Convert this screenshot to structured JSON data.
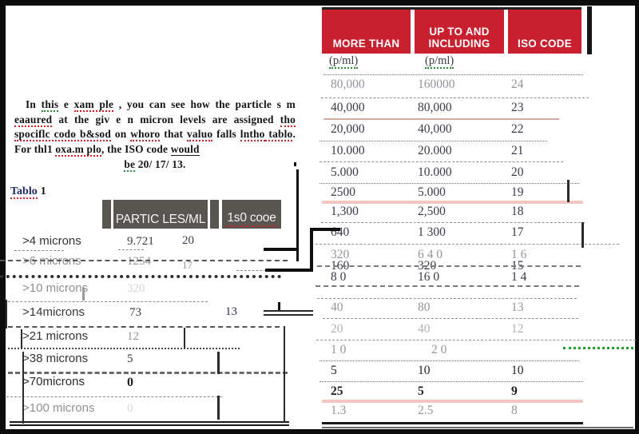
{
  "document": {
    "intro_paragraph": {
      "line1_pre": "In ",
      "line1_a": "this",
      "line1_b": " e ",
      "line1_c": "xam ple",
      "line1_d": " , you can see  how the particle s",
      "line2_a": "m ",
      "line2_b": "eaaured",
      "line2_c": " at the giv e n  micron  levels  are  assigned",
      "line3_a": "tho",
      "line3_b": " spociflc codo b&sod",
      "line3_c": " on ",
      "line3_d": "whoro",
      "line3_e": " that ",
      "line3_f": "valuo",
      "line3_g": " falls",
      "line4_a": "lntho",
      "line4_b": " tablo",
      "line4_c": ". For thl1 ",
      "line4_d": "oxa.m plo",
      "line4_e": ", the ISO code ",
      "line4_f": "would",
      "line5_a": "be",
      "line5_b": " 20/ 17/ 13.",
      "full_text": "In this e xam ple , you can see how the particle s m eaaured at the given micron levels are assigned tho spociflc codo b&sod on whoro that valuo falls lntho tablo. For thl1 oxa.m plo, the ISO code would be 20/17/13."
    },
    "table1_caption": {
      "word": "Tablo",
      "number": "1"
    }
  },
  "left_table": {
    "name": "Tablo 1 particle count table",
    "header": {
      "block_a": "",
      "particles_label": "PARTIC LES/ML",
      "block_c": "",
      "iso_label": "1s0 cooe"
    },
    "rows": [
      {
        "micron": ">4 microns",
        "count": "9.721",
        "iso": "20"
      },
      {
        "micron": ">6 microns",
        "count": "1254",
        "iso": "17"
      },
      {
        "micron": ">10 microns",
        "count": "320",
        "iso": ""
      },
      {
        "micron": ">14microns",
        "count": "73",
        "iso": "13"
      },
      {
        "micron": ">21 microns",
        "count": "12",
        "iso": ""
      },
      {
        "micron": ">38 microns",
        "count": "5",
        "iso": ""
      },
      {
        "micron": ">70microns",
        "count": "0",
        "iso": ""
      },
      {
        "micron": ">100 microns",
        "count": "0",
        "iso": ""
      }
    ]
  },
  "right_table": {
    "name": "ISO 4406 code lookup chart",
    "header": {
      "col1": "MORE THAN",
      "col2_line1": "UP TO AND",
      "col2_line2": "INCLUDING",
      "col3": "ISO CODE"
    },
    "units": {
      "col1": "(p/ml)",
      "col2": "(p/ml)"
    },
    "rows": [
      {
        "more_than": "80,000",
        "up_to": "160000",
        "iso": "24"
      },
      {
        "more_than": "40,000",
        "up_to": "80,000",
        "iso": "23"
      },
      {
        "more_than": "20,000",
        "up_to": "40,000",
        "iso": "22"
      },
      {
        "more_than": "10.000",
        "up_to": "20.000",
        "iso": "21"
      },
      {
        "more_than": "5.000",
        "up_to": "10.000",
        "iso": "20"
      },
      {
        "more_than": "2500",
        "up_to": "5.000",
        "iso": "19"
      },
      {
        "more_than": "1,300",
        "up_to": "2,500",
        "iso": "18"
      },
      {
        "more_than": "640",
        "up_to": "1 300",
        "iso": "17"
      },
      {
        "more_than": "320",
        "up_to": "6 4 0",
        "iso": "1 6"
      },
      {
        "more_than": "160",
        "up_to": "320",
        "iso": "15"
      },
      {
        "more_than": "8 0",
        "up_to": "16 0",
        "iso": "1 4"
      },
      {
        "more_than": "40",
        "up_to": "80",
        "iso": "13"
      },
      {
        "more_than": "20",
        "up_to": "40",
        "iso": "12"
      },
      {
        "more_than": "1 0",
        "up_to": "2 0",
        "iso": ""
      },
      {
        "more_than": "5",
        "up_to": "10",
        "iso": "10"
      },
      {
        "more_than": "25",
        "up_to": "5",
        "iso": "9"
      },
      {
        "more_than": "1.3",
        "up_to": "2.5",
        "iso": "8"
      }
    ]
  },
  "colors": {
    "header_red": "#c8202e",
    "header_gray": "#595550",
    "frame_black": "#0c0c0c",
    "highlight_pink": "#f3c6c2",
    "caption_navy": "#1c2a5e",
    "spell_red": "#cc2222",
    "spell_green": "#22a02b"
  }
}
